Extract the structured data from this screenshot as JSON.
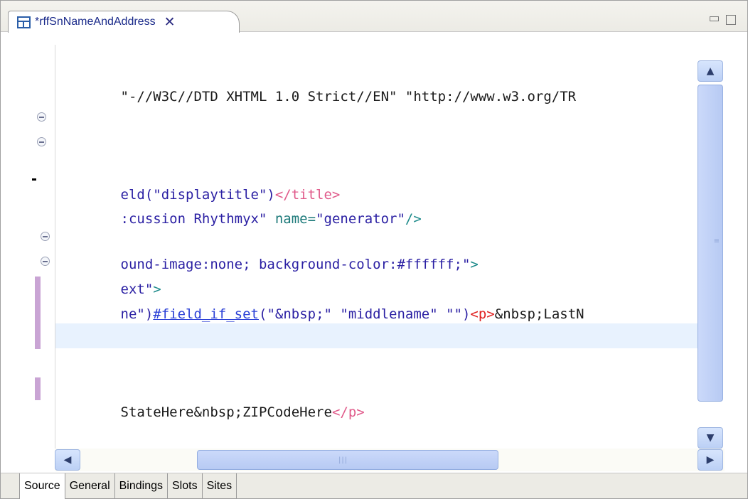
{
  "tab": {
    "title": "*rffSnNameAndAddress",
    "close": "✕"
  },
  "code": {
    "line1": "\"-//W3C//DTD XHTML 1.0 Strict//EN\" \"http://www.w3.org/TR",
    "line4_text": "eld(\"displaytitle\")",
    "line4_tag": "</title>",
    "line5_text": ":cussion Rhythmyx\"",
    "line5_attr": " name=",
    "line5_val": "\"generator\"",
    "line5_close": "/>",
    "line7_text": "ound-image:none; background-color:#ffffff;\"",
    "line7_close": ">",
    "line8_text": "ext\"",
    "line8_close": ">",
    "line9_a": "ne\")",
    "line9_vel": "#field_if_set",
    "line9_b": "(\"&nbsp;\" \"middlename\" \"\")",
    "line9_tag": "<p>",
    "line9_c": "&nbsp;LastN",
    "line11_text": "StateHere&nbsp;ZIPCodeHere",
    "line11_tag": "</p>"
  },
  "bottom_tabs": [
    "Source",
    "General",
    "Bindings",
    "Slots",
    "Sites"
  ],
  "icons": {
    "editor": "editor-layout-icon",
    "minimize": "minimize-icon",
    "maximize": "maximize-icon",
    "scroll_up": "▲",
    "scroll_down": "▼",
    "scroll_left": "◀",
    "scroll_right": "▶",
    "grip_v": "≡",
    "grip_h": "|||"
  }
}
